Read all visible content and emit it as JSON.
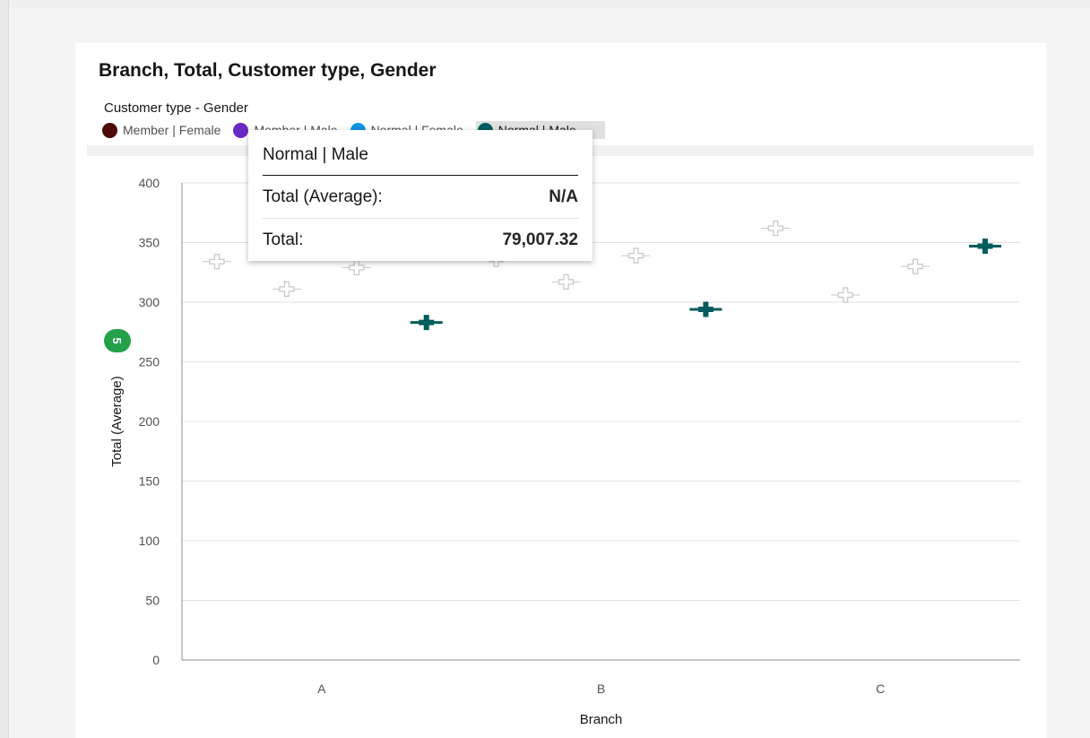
{
  "colors": {
    "member_female": "#4d0a06",
    "member_male": "#6929c4",
    "normal_female": "#1192e8",
    "normal_male": "#005d5d",
    "faded_marker": "#c6c6c6",
    "badge": "#24a148"
  },
  "chart_data": {
    "type": "scatter",
    "title": "Branch, Total, Customer type, Gender",
    "xlabel": "Branch",
    "ylabel": "Total (Average)",
    "categories": [
      "A",
      "B",
      "C"
    ],
    "ylim": [
      0,
      400
    ],
    "yticks": [
      0,
      50,
      100,
      150,
      200,
      250,
      300,
      350,
      400
    ],
    "grid": true,
    "legend_title": "Customer type - Gender",
    "legend_position": "top-left",
    "series": [
      {
        "name": "Member | Female",
        "values": [
          334,
          336,
          362
        ],
        "highlighted": false
      },
      {
        "name": "Member | Male",
        "values": [
          311,
          317,
          306
        ],
        "highlighted": false
      },
      {
        "name": "Normal | Female",
        "values": [
          329,
          339,
          330
        ],
        "highlighted": false
      },
      {
        "name": "Normal | Male",
        "values": [
          283,
          294,
          347
        ],
        "highlighted": true
      }
    ]
  },
  "badge": {
    "label": "5"
  },
  "tooltip": {
    "header": "Normal | Male",
    "rows": [
      {
        "label": "Total (Average):",
        "value": "N/A"
      },
      {
        "label": "Total:",
        "value": "79,007.32"
      }
    ]
  }
}
